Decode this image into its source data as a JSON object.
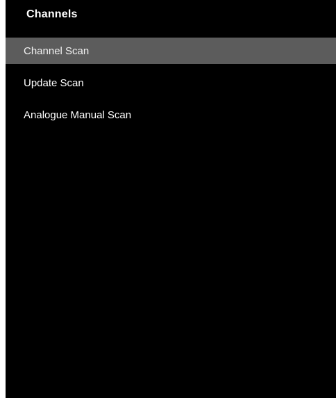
{
  "panel": {
    "title": "Channels"
  },
  "menu": {
    "items": [
      {
        "label": "Channel Scan",
        "selected": true
      },
      {
        "label": "Update Scan",
        "selected": false
      },
      {
        "label": "Analogue Manual Scan",
        "selected": false
      }
    ]
  },
  "colors": {
    "background": "#000000",
    "selected_row": "#5c5c5c",
    "text": "#ffffff"
  }
}
